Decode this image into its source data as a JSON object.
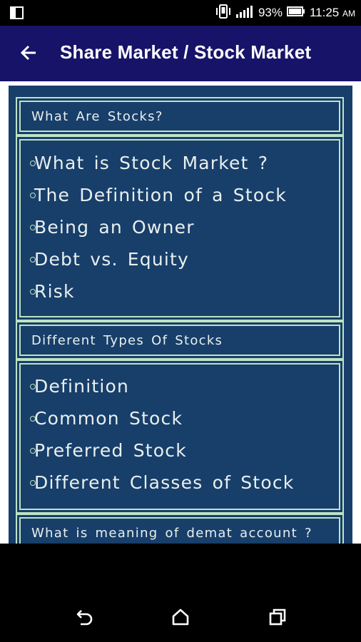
{
  "status_bar": {
    "battery_percent": "93%",
    "time": "11:25",
    "ampm": "AM",
    "icons": [
      "notification-icon",
      "vibrate-icon",
      "signal-icon",
      "battery-icon"
    ]
  },
  "app_bar": {
    "title": "Share Market / Stock Market",
    "back_icon": "arrow-left-icon"
  },
  "sections": [
    {
      "header": "What Are Stocks?",
      "items": [
        "What is Stock Market ?",
        "The Definition of a Stock",
        "Being an Owner",
        "Debt vs. Equity",
        "Risk"
      ]
    },
    {
      "header": "Different Types Of Stocks",
      "items": [
        "Definition",
        "Common Stock",
        "Preferred Stock",
        "Different Classes of Stock"
      ]
    },
    {
      "header": "What is meaning of demat account ?",
      "items": []
    }
  ],
  "nav_bar": {
    "icons": [
      "back-icon",
      "home-icon",
      "recents-icon"
    ]
  },
  "colors": {
    "app_bar": "#171368",
    "panel": "#183e6a",
    "border": "#bde3c3",
    "text": "#e8f0ef"
  }
}
